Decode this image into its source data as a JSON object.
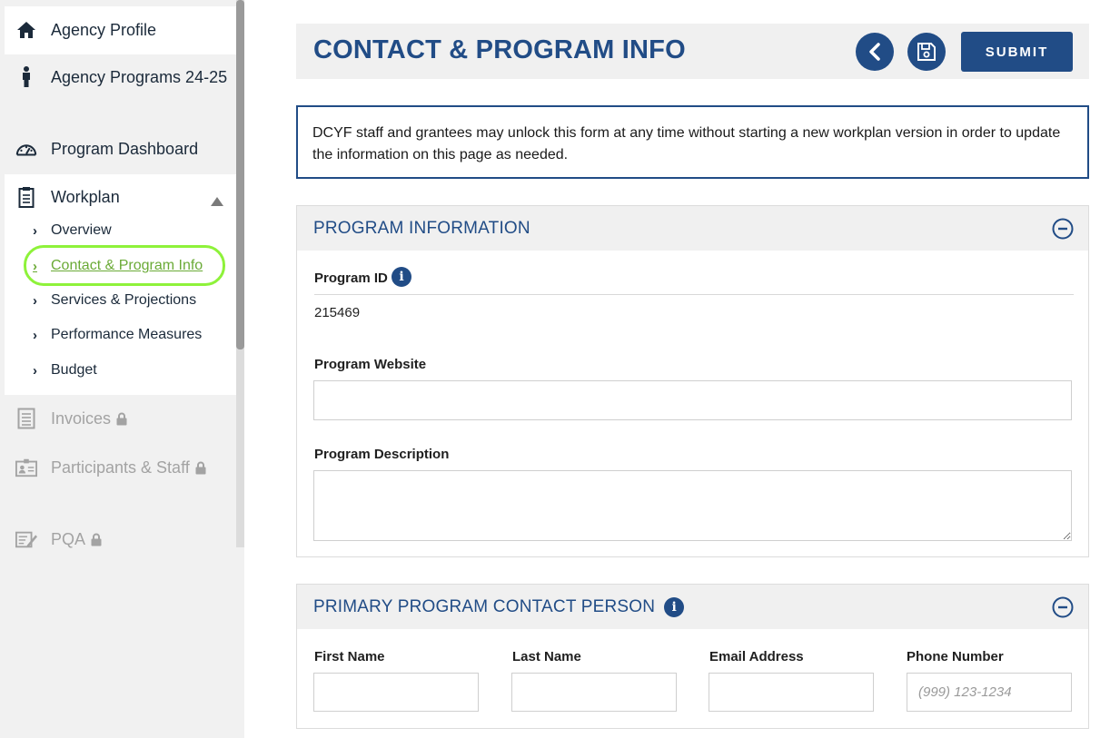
{
  "sidebar": {
    "items": [
      {
        "label": "Agency Profile",
        "icon": "home-icon"
      },
      {
        "label": "Agency Programs 24-25",
        "icon": "person-icon"
      },
      {
        "label": "Program Dashboard",
        "icon": "gauge-icon"
      },
      {
        "label": "Workplan",
        "icon": "clipboard-icon"
      },
      {
        "label": "Invoices",
        "icon": "document-icon",
        "locked": true
      },
      {
        "label": "Participants & Staff",
        "icon": "id-card-icon",
        "locked": true
      },
      {
        "label": "PQA",
        "icon": "edit-list-icon",
        "locked": true
      }
    ],
    "workplan_sub": [
      {
        "label": "Overview"
      },
      {
        "label": "Contact & Program Info",
        "active": true
      },
      {
        "label": "Services & Projections"
      },
      {
        "label": "Performance Measures"
      },
      {
        "label": "Budget"
      }
    ]
  },
  "header": {
    "title": "CONTACT & PROGRAM INFO",
    "submit_label": "SUBMIT"
  },
  "notice": {
    "text": "DCYF staff and grantees may unlock this form at any time without starting a new workplan version in order to update the information on this page as needed."
  },
  "program_info": {
    "title": "PROGRAM INFORMATION",
    "program_id_label": "Program ID",
    "program_id_value": "215469",
    "website_label": "Program Website",
    "website_value": "",
    "description_label": "Program Description",
    "description_value": ""
  },
  "contact": {
    "title": "PRIMARY PROGRAM CONTACT PERSON",
    "first_name_label": "First Name",
    "last_name_label": "Last Name",
    "email_label": "Email Address",
    "phone_label": "Phone Number",
    "phone_placeholder": "(999) 123-1234"
  },
  "colors": {
    "brand": "#214c86",
    "active_link": "#6aaa36",
    "highlight": "#8ef23a"
  }
}
